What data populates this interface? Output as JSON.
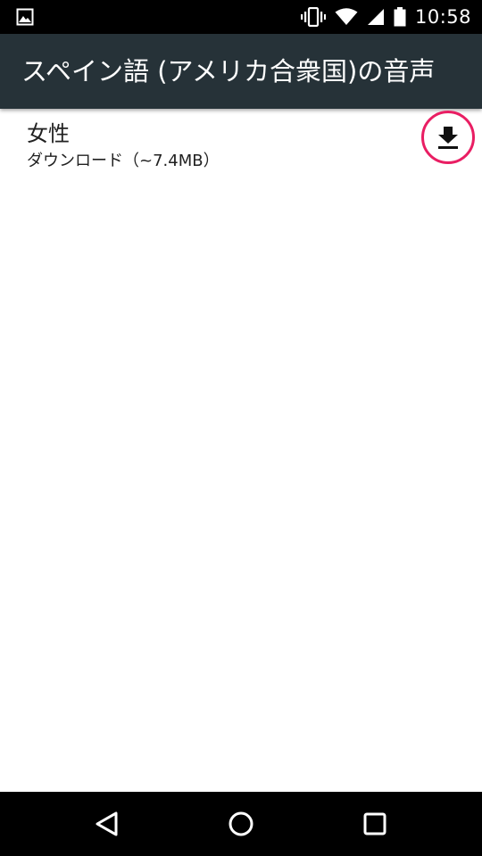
{
  "status_bar": {
    "time": "10:58",
    "icons": [
      "image-notification-icon",
      "vibrate-icon",
      "wifi-icon",
      "cell-signal-icon",
      "battery-icon"
    ]
  },
  "app_bar": {
    "title": "スペイン語 (アメリカ合衆国)の音声",
    "background": "#263238"
  },
  "voices": [
    {
      "title": "女性",
      "subtitle": "ダウンロード（~7.4MB）",
      "action_icon": "download-icon"
    }
  ],
  "colors": {
    "accent": "#e91e63",
    "status_bar": "#000000",
    "nav_bar": "#000000"
  },
  "nav_bar": {
    "buttons": [
      "back-icon",
      "home-icon",
      "recents-icon"
    ]
  }
}
